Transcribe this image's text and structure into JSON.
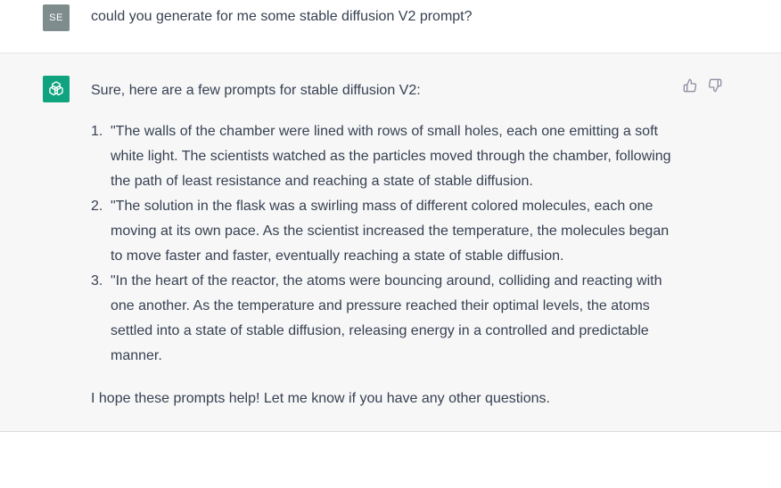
{
  "user": {
    "avatar_initials": "SE",
    "message": "could you generate for me some stable diffusion V2 prompt?"
  },
  "assistant": {
    "intro": "Sure, here are a few prompts for stable diffusion V2:",
    "prompts": [
      {
        "number": "1.",
        "text": "\"The walls of the chamber were lined with rows of small holes, each one emitting a soft white light. The scientists watched as the particles moved through the chamber, following the path of least resistance and reaching a state of stable diffusion."
      },
      {
        "number": "2.",
        "text": "\"The solution in the flask was a swirling mass of different colored molecules, each one moving at its own pace. As the scientist increased the temperature, the molecules began to move faster and faster, eventually reaching a state of stable diffusion."
      },
      {
        "number": "3.",
        "text": "\"In the heart of the reactor, the atoms were bouncing around, colliding and reacting with one another. As the temperature and pressure reached their optimal levels, the atoms settled into a state of stable diffusion, releasing energy in a controlled and predictable manner."
      }
    ],
    "outro": "I hope these prompts help! Let me know if you have any other questions."
  },
  "colors": {
    "user_avatar_bg": "#7f8c8d",
    "assistant_avatar_bg": "#10a37f",
    "assistant_row_bg": "#f7f7f8",
    "text": "#374151"
  },
  "icons": {
    "assistant_avatar": "openai-logo-icon",
    "feedback_up": "thumbs-up-icon",
    "feedback_down": "thumbs-down-icon"
  }
}
